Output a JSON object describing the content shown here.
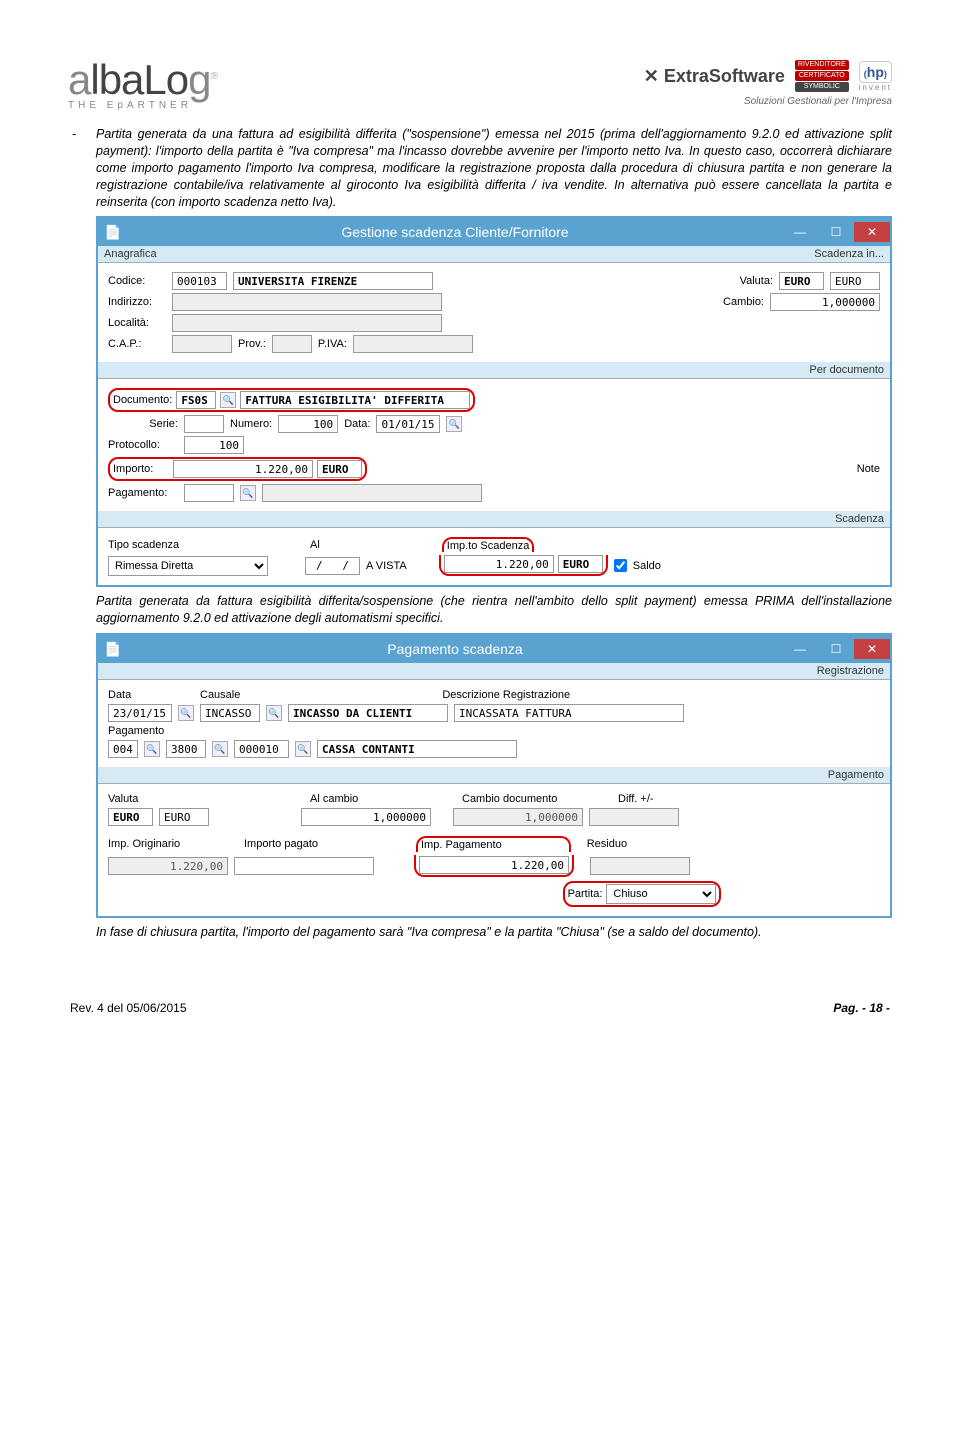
{
  "header": {
    "logo_text": "albaLog",
    "logo_tagline": "THE EpARTNER",
    "extra": "ExtraSoftware",
    "soluzioni": "Soluzioni Gestionali per l'Impresa",
    "badge1": "RIVENDITORE",
    "badge2": "CERTIFICATO",
    "badge3": "SYMBOLIC",
    "hp": "hp",
    "invent": "invent"
  },
  "para1_a": "Partita generata da una fattura ad esigibilità differita (\"sospensione\") emessa nel 2015 (prima dell'aggiornamento 9.2.0 ed attivazione split payment): l'importo della partita è \"Iva compresa\" ma l'incasso dovrebbe avvenire per l'importo netto Iva. In questo caso, occorrerà dichiarare come importo pagamento l'importo Iva compresa, modificare la registrazione proposta dalla procedura di chiusura partita e non generare la registrazione contabile/iva relativamente al giroconto Iva esigibilità differita / iva vendite. In alternativa può essere cancellata la partita e reinserita (con importo scadenza netto Iva).",
  "win1": {
    "title": "Gestione scadenza Cliente/Fornitore",
    "sec1_l": "Anagrafica",
    "sec1_r": "Scadenza in...",
    "codice_lbl": "Codice:",
    "codice_val": "000103",
    "codice_desc": "UNIVERSITA FIRENZE",
    "valuta_lbl": "Valuta:",
    "valuta_val": "EURO",
    "valuta_desc": "EURO",
    "indirizzo_lbl": "Indirizzo:",
    "cambio_lbl": "Cambio:",
    "cambio_val": "1,000000",
    "localita_lbl": "Località:",
    "cap_lbl": "C.A.P.:",
    "prov_lbl": "Prov.:",
    "piva_lbl": "P.IVA:",
    "sec2": "Per documento",
    "documento_lbl": "Documento:",
    "documento_val": "FS0S",
    "documento_desc": "FATTURA ESIGIBILITA' DIFFERITA",
    "serie_lbl": "Serie:",
    "numero_lbl": "Numero:",
    "numero_val": "100",
    "data_lbl": "Data:",
    "data_val": "01/01/15",
    "protocollo_lbl": "Protocollo:",
    "protocollo_val": "100",
    "importo_lbl": "Importo:",
    "importo_val": "1.220,00",
    "importo_cur": "EURO",
    "note_lbl": "Note",
    "pagamento_lbl": "Pagamento:",
    "sec3": "Scadenza",
    "tipo_lbl": "Tipo scadenza",
    "tipo_val": "Rimessa Diretta",
    "al_lbl": "Al",
    "al_val": "/   /",
    "al_desc": "A VISTA",
    "impsca_lbl": "Imp.to Scadenza",
    "impsca_val": "1.220,00",
    "impsca_cur": "EURO",
    "saldo_lbl": "Saldo"
  },
  "para2": "Partita generata da fattura esigibilità differita/sospensione (che rientra nell'ambito dello split payment) emessa PRIMA dell'installazione aggiornamento 9.2.0 ed attivazione degli automatismi specifici.",
  "win2": {
    "title": "Pagamento scadenza",
    "sec1": "Registrazione",
    "data_lbl": "Data",
    "data_val": "23/01/15",
    "causale_lbl": "Causale",
    "causale_val": "INCASSO",
    "causale_desc": "INCASSO DA CLIENTI",
    "descr_lbl": "Descrizione Registrazione",
    "descr_val": "INCASSATA FATTURA",
    "pag_lbl": "Pagamento",
    "pag_v1": "004",
    "pag_v2": "3800",
    "pag_v3": "000010",
    "pag_desc": "CASSA CONTANTI",
    "sec2": "Pagamento",
    "valuta_lbl": "Valuta",
    "valuta_v1": "EURO",
    "valuta_v2": "EURO",
    "alcambio_lbl": "Al cambio",
    "alcambio_val": "1,000000",
    "cambdoc_lbl": "Cambio documento",
    "cambdoc_val": "1,000000",
    "diff_lbl": "Diff. +/-",
    "imporig_lbl": "Imp. Originario",
    "imporig_val": "1.220,00",
    "imppag_lbl": "Importo pagato",
    "imppagam_lbl": "Imp. Pagamento",
    "imppagam_val": "1.220,00",
    "residuo_lbl": "Residuo",
    "partita_lbl": "Partita:",
    "partita_val": "Chiuso"
  },
  "para3": "In fase di chiusura partita, l'importo del pagamento sarà \"Iva compresa\" e la partita \"Chiusa\" (se a saldo del documento).",
  "footer": {
    "rev": "Rev. 4 del 05/06/2015",
    "page": "Pag. - 18 -"
  }
}
